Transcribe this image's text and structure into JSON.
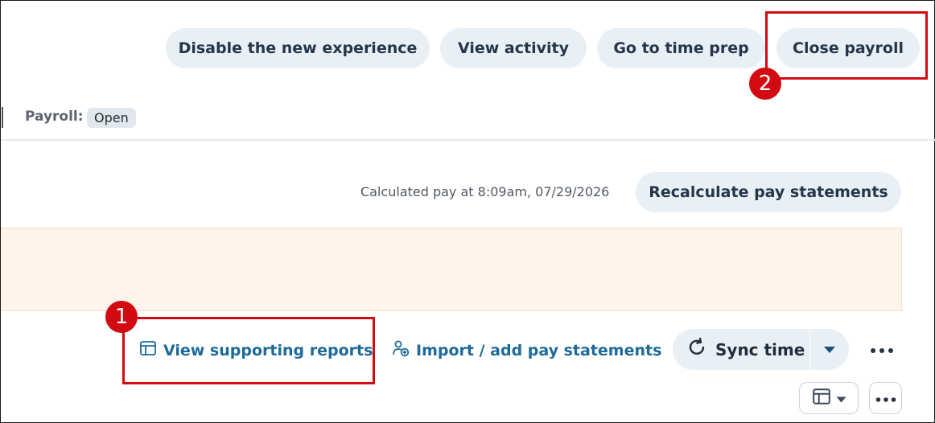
{
  "header": {
    "disable_label": "Disable the new experience",
    "activity_label": "View activity",
    "timeprep_label": "Go to time prep",
    "close_label": "Close payroll"
  },
  "status": {
    "payroll_label": "Payroll:",
    "payroll_state": "Open"
  },
  "calc": {
    "text": "Calculated pay at 8:09am, 07/29/2026",
    "recalc_label": "Recalculate pay statements"
  },
  "actions": {
    "reports_label": "View supporting reports",
    "import_label": "Import / add pay statements",
    "sync_label": "Sync time"
  },
  "annotations": {
    "one": "1",
    "two": "2"
  },
  "icons": {
    "reports": "table-icon",
    "import": "person-add-icon",
    "sync": "refresh-icon",
    "caret": "caret-down-icon",
    "more": "more-horizontal-icon"
  },
  "colors": {
    "pill_bg": "#e8f0f5",
    "link": "#1d6a99",
    "banner_bg": "#fff4ea",
    "annotation": "#d20a11"
  }
}
